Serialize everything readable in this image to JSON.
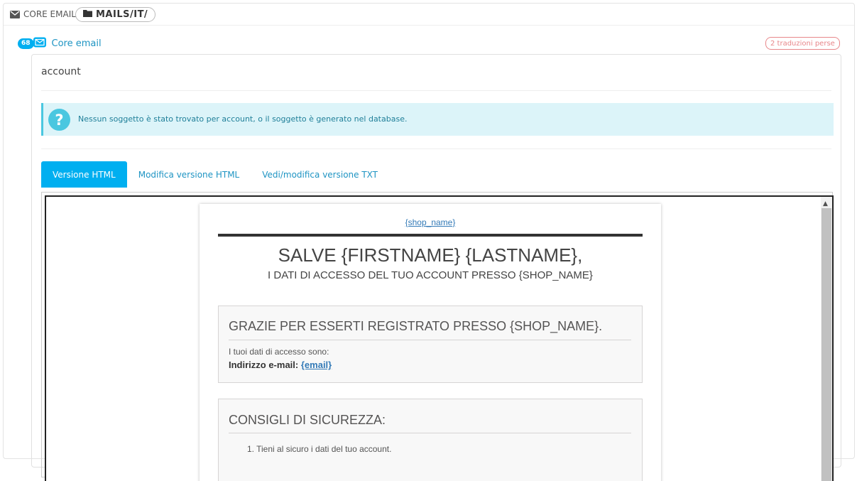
{
  "breadcrumb": {
    "core_label": "CORE EMAIL",
    "folder_label": "MAILS/IT/"
  },
  "section": {
    "badge_count": "68",
    "title": "Core email",
    "lost_translations": "2 traduzioni perse"
  },
  "template": {
    "name": "account",
    "alert": "Nessun soggetto è stato trovato per account, o il soggetto è generato nel database."
  },
  "tabs": [
    {
      "label": "Versione HTML",
      "active": true
    },
    {
      "label": "Modifica versione HTML",
      "active": false
    },
    {
      "label": "Vedi/modifica versione TXT",
      "active": false
    }
  ],
  "email": {
    "shop_link": "{shop_name}",
    "greeting": "SALVE {FIRSTNAME} {LASTNAME},",
    "subtitle": "I DATI DI ACCESSO DEL TUO ACCOUNT PRESSO {SHOP_NAME}",
    "box1": {
      "title": "GRAZIE PER ESSERTI REGISTRATO PRESSO {SHOP_NAME}.",
      "line1": "I tuoi dati di accesso sono:",
      "email_label": "Indirizzo e-mail:",
      "email_value": "{email}"
    },
    "box2": {
      "title": "CONSIGLI DI SICUREZZA:",
      "item1": "1. Tieni al sicuro i dati del tuo account."
    }
  },
  "colors": {
    "accent": "#00aff0",
    "link": "#1e94c3",
    "alert_bg": "#dcf4f9",
    "lost_badge": "#e8878a"
  }
}
